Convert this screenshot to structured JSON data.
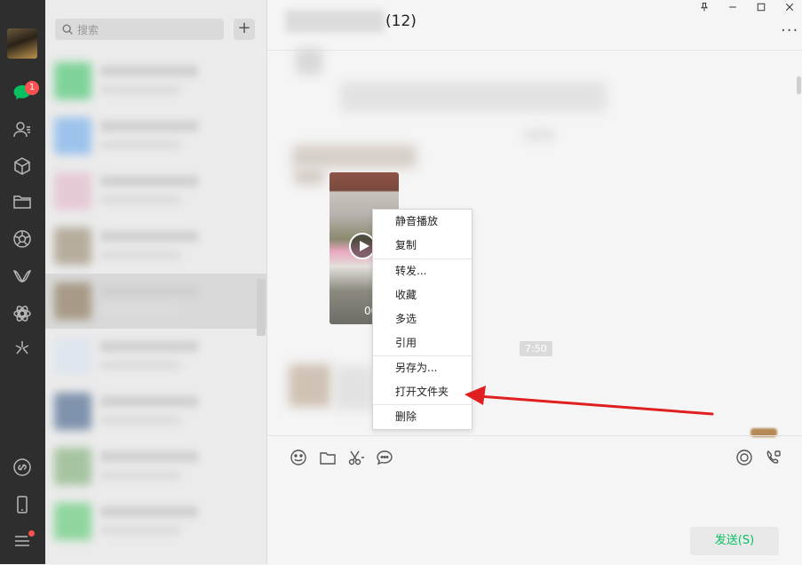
{
  "search": {
    "placeholder": "搜索"
  },
  "sidebar": {
    "unread_badge": "1"
  },
  "chat": {
    "title_count": "(12)",
    "video_duration": "00",
    "time_stamp": "7:50",
    "more_label": "···"
  },
  "window": {
    "pin": "⊥",
    "minimize": "—",
    "maximize": "☐",
    "close": "✕"
  },
  "context_menu": {
    "items": [
      "静音播放",
      "复制",
      "转发...",
      "收藏",
      "多选",
      "引用",
      "另存为...",
      "打开文件夹",
      "删除"
    ]
  },
  "composer": {
    "send_label": "发送(S)"
  },
  "colors": {
    "accent_green": "#07c160",
    "badge_red": "#fa5151",
    "arrow_red": "#e02020"
  }
}
